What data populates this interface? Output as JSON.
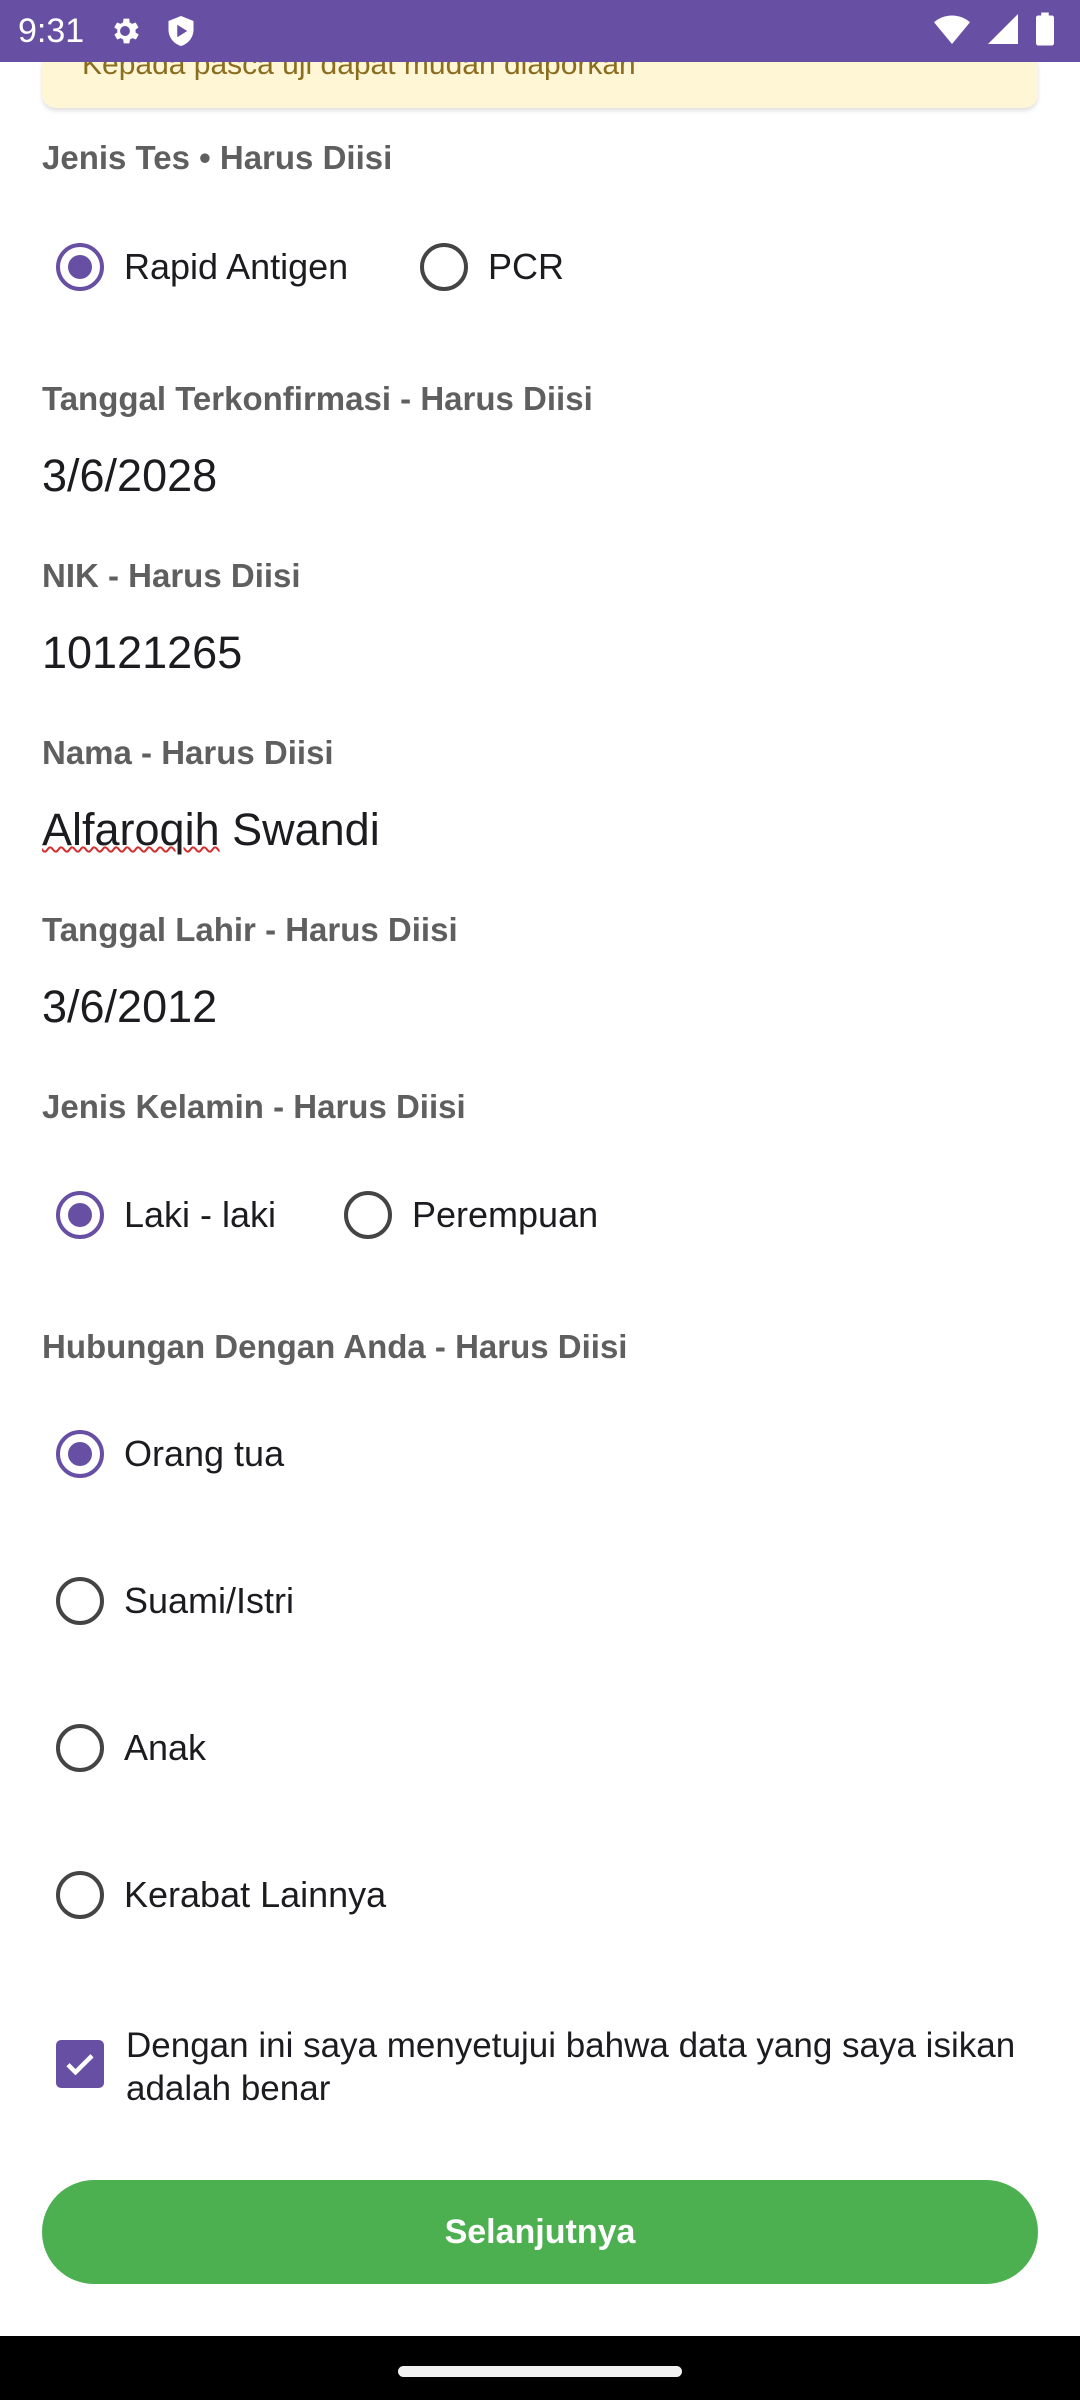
{
  "status_bar": {
    "time": "9:31",
    "settings_icon": "gear-icon",
    "shield_icon": "shield-icon",
    "wifi_icon": "wifi-icon",
    "signal_icon": "signal-icon",
    "battery_icon": "battery-icon"
  },
  "banner": {
    "text": "Kepada pasca uji dapat mudah diaporkan"
  },
  "form": {
    "test_type": {
      "label": "Jenis Tes • Harus Diisi",
      "options": [
        "Rapid Antigen",
        "PCR"
      ],
      "selected": "Rapid Antigen"
    },
    "confirmed_date": {
      "label": "Tanggal Terkonfirmasi - Harus Diisi",
      "value": "3/6/2028"
    },
    "nik": {
      "label": "NIK - Harus Diisi",
      "value": "10121265"
    },
    "name": {
      "label": "Nama - Harus Diisi",
      "first": "Alfaroqih",
      "last": " Swandi"
    },
    "birth_date": {
      "label": "Tanggal Lahir - Harus Diisi",
      "value": "3/6/2012"
    },
    "gender": {
      "label": "Jenis Kelamin - Harus Diisi",
      "options": [
        "Laki - laki",
        "Perempuan"
      ],
      "selected": "Laki - laki"
    },
    "relation": {
      "label": "Hubungan Dengan Anda - Harus Diisi",
      "options": [
        "Orang tua",
        "Suami/Istri",
        "Anak",
        "Kerabat Lainnya"
      ],
      "selected": "Orang tua"
    },
    "agreement": {
      "text": "Dengan ini saya menyetujui bahwa data yang saya isikan adalah benar",
      "checked": true
    },
    "next_button": "Selanjutnya"
  },
  "colors": {
    "primary": "#6750a4",
    "button": "#4caf50",
    "banner": "#fff6d6"
  }
}
